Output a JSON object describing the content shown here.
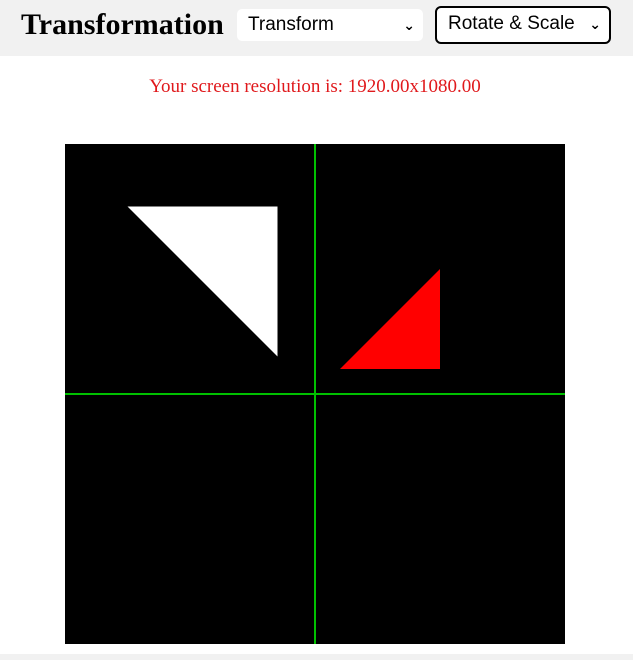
{
  "header": {
    "title": "Transformation",
    "mode_select": {
      "value": "Transform"
    },
    "operation_select": {
      "value": "Rotate & Scale"
    }
  },
  "main": {
    "resolution_text": "Your screen resolution is: 1920.00x1080.00"
  },
  "canvas": {
    "background": "#000000",
    "axis_color": "#00c000",
    "shapes": [
      {
        "name": "original-triangle",
        "color": "#ffffff",
        "points": [
          [
            -0.75,
            0.75
          ],
          [
            -0.15,
            0.75
          ],
          [
            -0.15,
            0.15
          ]
        ]
      },
      {
        "name": "transformed-triangle",
        "color": "#ff0000",
        "points": [
          [
            0.5,
            0.5
          ],
          [
            0.5,
            0.1
          ],
          [
            0.1,
            0.1
          ]
        ]
      }
    ]
  }
}
